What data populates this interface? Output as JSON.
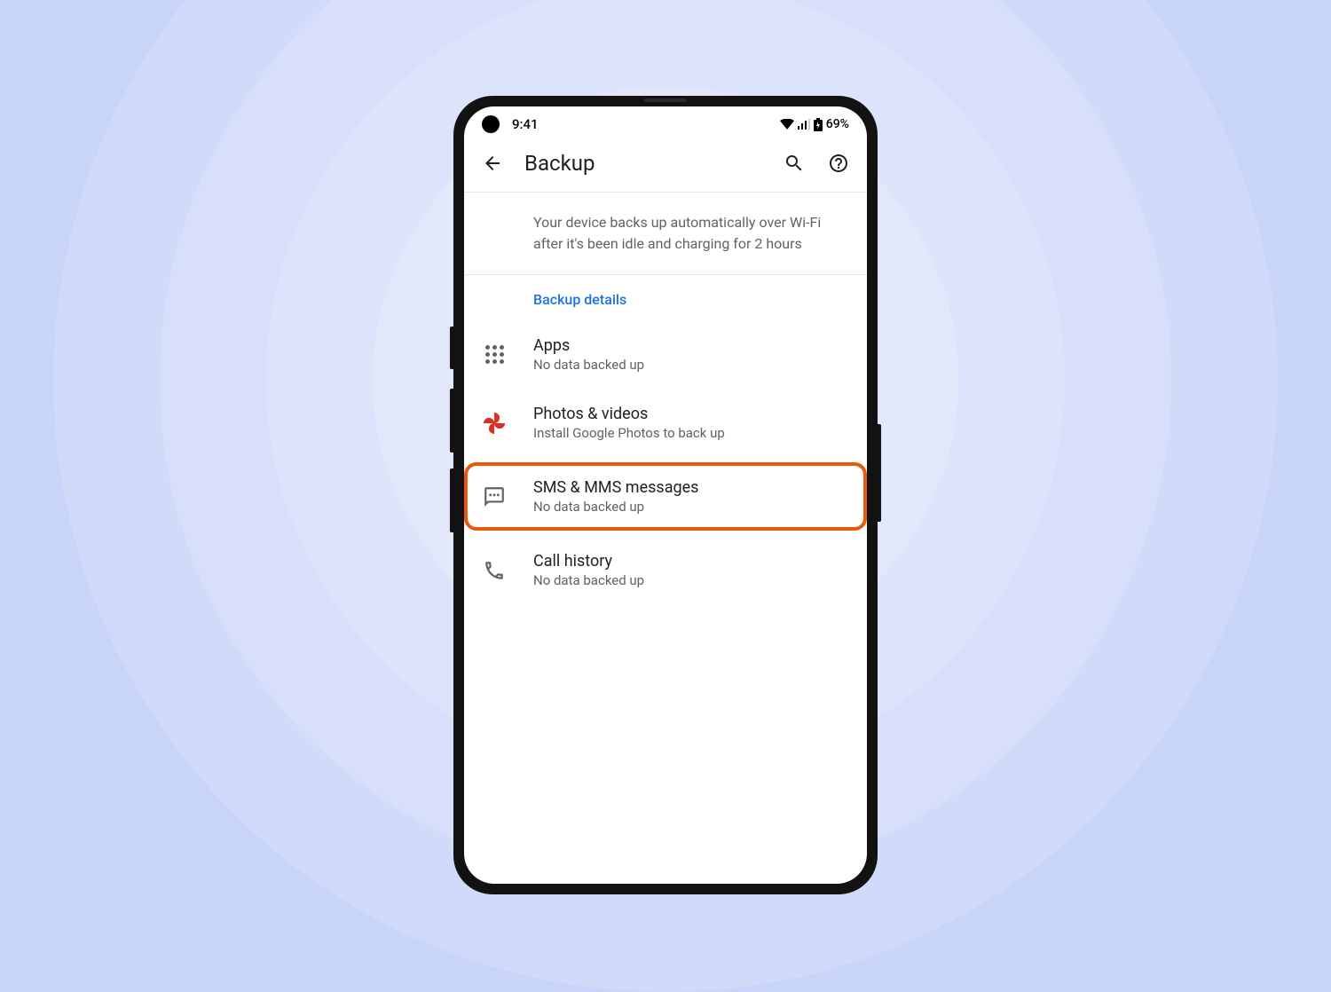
{
  "statusbar": {
    "time": "9:41",
    "battery": "69%"
  },
  "appbar": {
    "title": "Backup"
  },
  "info": "Your device backs up automatically over Wi-Fi after it's been idle and charging for 2 hours",
  "section_header": "Backup details",
  "items": {
    "apps": {
      "title": "Apps",
      "subtitle": "No data backed up"
    },
    "photos": {
      "title": "Photos & videos",
      "subtitle": "Install Google Photos to back up"
    },
    "sms": {
      "title": "SMS & MMS messages",
      "subtitle": "No data backed up"
    },
    "calls": {
      "title": "Call history",
      "subtitle": "No data backed up"
    }
  },
  "highlight": {
    "color": "#e8590c",
    "target": "sms"
  }
}
